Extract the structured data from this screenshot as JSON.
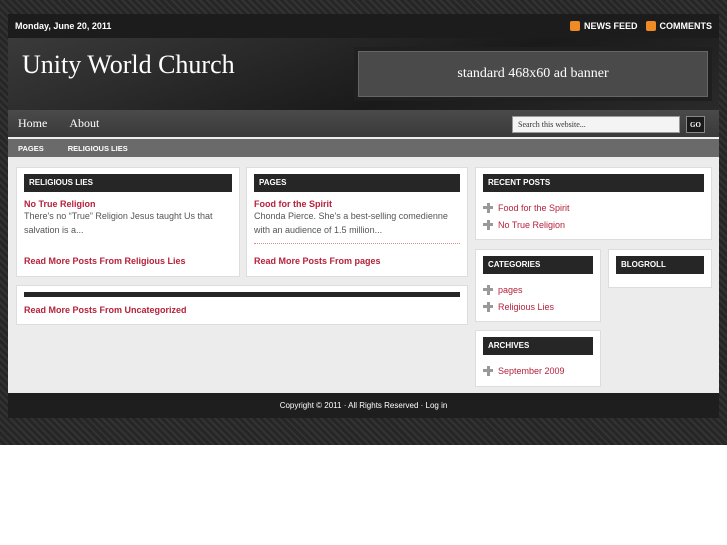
{
  "topbar": {
    "date": "Monday, June 20, 2011",
    "news_feed": "NEWS FEED",
    "comments": "COMMENTS"
  },
  "header": {
    "site_title": "Unity World Church",
    "ad_banner": "standard 468x60 ad banner"
  },
  "nav": {
    "items": [
      "Home",
      "About"
    ],
    "search_placeholder": "Search this website...",
    "go": "GO"
  },
  "subnav": {
    "items": [
      "PAGES",
      "RELIGIOUS LIES"
    ]
  },
  "main": {
    "religious_lies": {
      "title": "RELIGIOUS LIES",
      "post_title": "No True Religion",
      "excerpt": "There's no “True” Religion Jesus taught Us that salvation is a...",
      "more": "Read More Posts From Religious Lies"
    },
    "pages": {
      "title": "PAGES",
      "post_title": "Food for the Spirit",
      "excerpt": "Chonda Pierce. She's a best-selling comedienne with an audience of 1.5 million...",
      "more": "Read More Posts From pages"
    },
    "uncategorized": {
      "more": "Read More Posts From Uncategorized"
    }
  },
  "sidebar": {
    "recent_posts": {
      "title": "RECENT POSTS",
      "items": [
        "Food for the Spirit",
        "No True Religion"
      ]
    },
    "categories": {
      "title": "CATEGORIES",
      "items": [
        "pages",
        "Religious Lies"
      ]
    },
    "blogroll": {
      "title": "BLOGROLL"
    },
    "archives": {
      "title": "ARCHIVES",
      "items": [
        "September 2009"
      ]
    }
  },
  "footer": {
    "copyright": "Copyright © 2011 · All Rights Reserved · ",
    "login": "Log in"
  }
}
